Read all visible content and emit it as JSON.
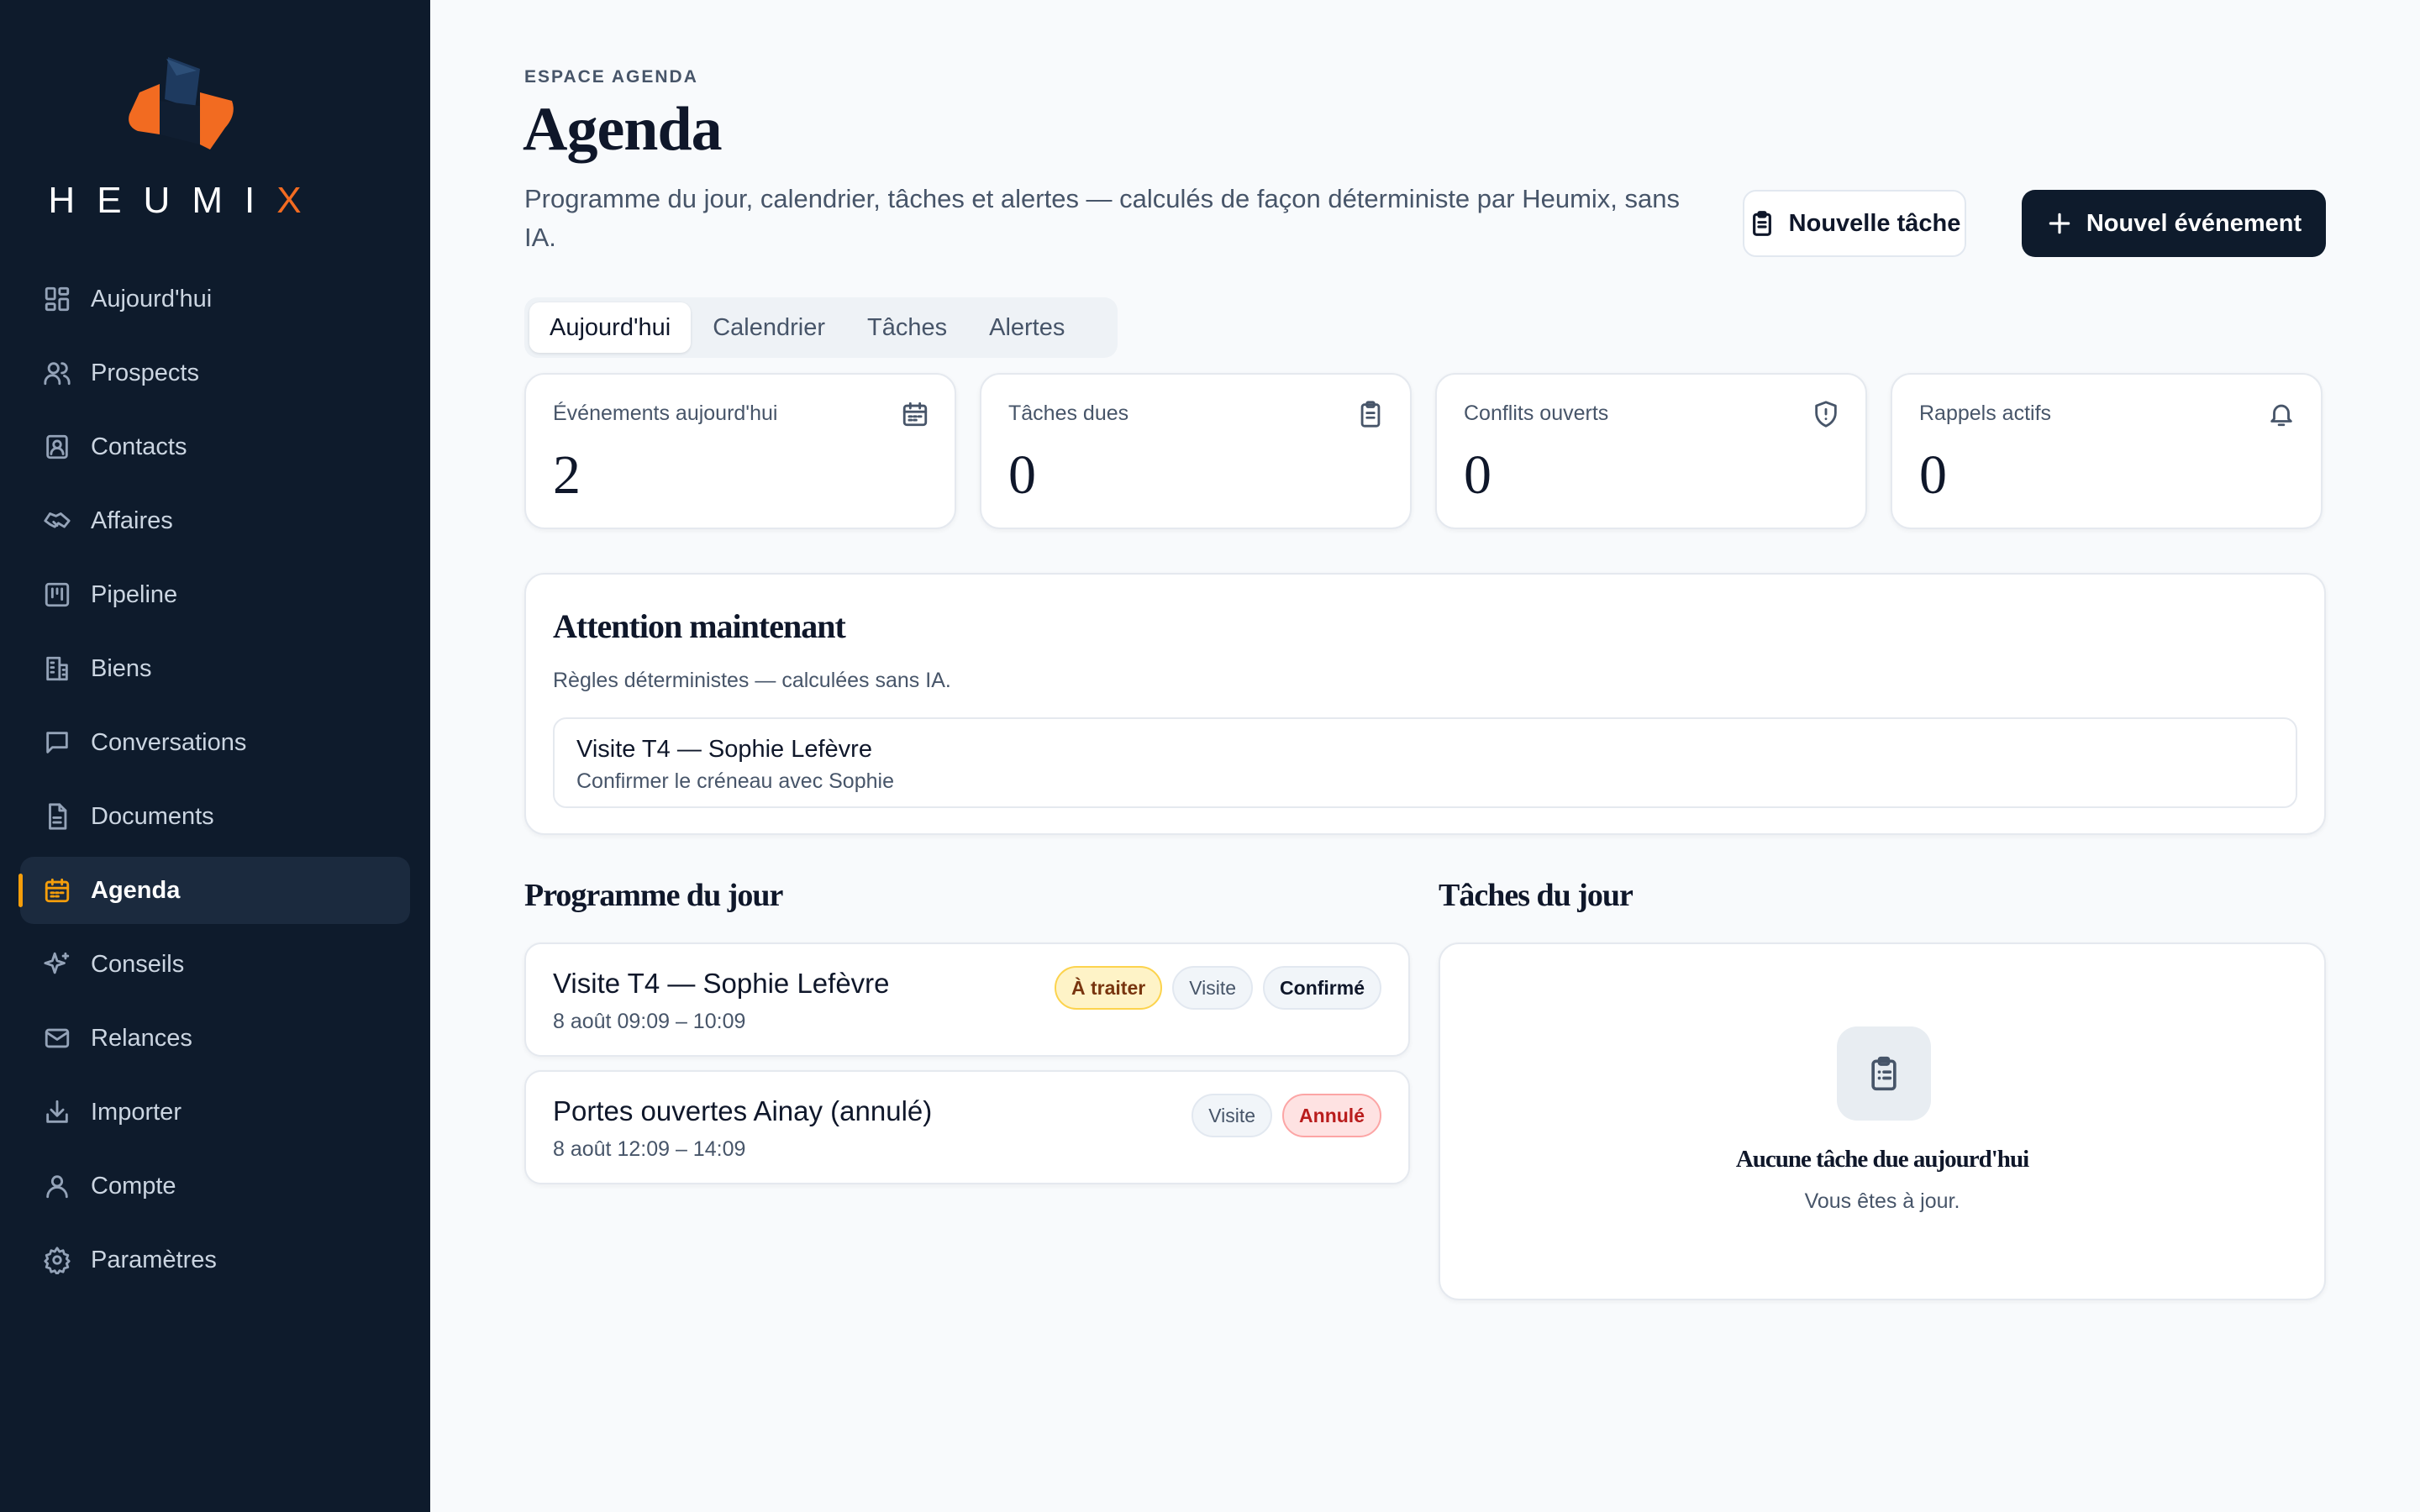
{
  "brand": {
    "name_main": "HEUMI",
    "name_accent": "X",
    "accent_color": "#f26b21",
    "dark_color": "#0e1b2c"
  },
  "sidebar": {
    "items": [
      {
        "label": "Aujourd'hui",
        "icon": "dashboard-icon"
      },
      {
        "label": "Prospects",
        "icon": "users-icon"
      },
      {
        "label": "Contacts",
        "icon": "contact-card-icon"
      },
      {
        "label": "Affaires",
        "icon": "handshake-icon"
      },
      {
        "label": "Pipeline",
        "icon": "kanban-icon"
      },
      {
        "label": "Biens",
        "icon": "building-icon"
      },
      {
        "label": "Conversations",
        "icon": "chat-icon"
      },
      {
        "label": "Documents",
        "icon": "file-text-icon"
      },
      {
        "label": "Agenda",
        "icon": "calendar-icon",
        "active": true
      },
      {
        "label": "Conseils",
        "icon": "sparkles-icon"
      },
      {
        "label": "Relances",
        "icon": "mail-icon"
      },
      {
        "label": "Importer",
        "icon": "import-icon"
      },
      {
        "label": "Compte",
        "icon": "user-icon"
      },
      {
        "label": "Paramètres",
        "icon": "gear-icon"
      }
    ]
  },
  "header": {
    "eyebrow": "ESPACE AGENDA",
    "title": "Agenda",
    "subtitle": "Programme du jour, calendrier, tâches et alertes — calculés de façon déterministe par Heumix, sans IA.",
    "new_task_label": "Nouvelle tâche",
    "new_event_label": "Nouvel événement"
  },
  "tabs": [
    {
      "label": "Aujourd'hui",
      "active": true
    },
    {
      "label": "Calendrier"
    },
    {
      "label": "Tâches"
    },
    {
      "label": "Alertes"
    }
  ],
  "stats": [
    {
      "label": "Événements aujourd'hui",
      "value": "2",
      "icon": "calendar-icon"
    },
    {
      "label": "Tâches dues",
      "value": "0",
      "icon": "clipboard-icon"
    },
    {
      "label": "Conflits ouverts",
      "value": "0",
      "icon": "shield-alert-icon"
    },
    {
      "label": "Rappels actifs",
      "value": "0",
      "icon": "bell-icon"
    }
  ],
  "attention": {
    "title": "Attention maintenant",
    "subtitle": "Règles déterministes — calculées sans IA.",
    "items": [
      {
        "title": "Visite T4 — Sophie Lefèvre",
        "subtitle": "Confirmer le créneau avec Sophie"
      }
    ]
  },
  "programme": {
    "title": "Programme du jour",
    "events": [
      {
        "title": "Visite T4 — Sophie Lefèvre",
        "time": "8 août 09:09 – 10:09",
        "badges": [
          "À traiter",
          "Visite",
          "Confirmé"
        ]
      },
      {
        "title": "Portes ouvertes Ainay (annulé)",
        "time": "8 août 12:09 – 14:09",
        "badges": [
          "Visite",
          "Annulé"
        ]
      }
    ]
  },
  "tasks": {
    "title": "Tâches du jour",
    "empty_title": "Aucune tâche due aujourd'hui",
    "empty_subtitle": "Vous êtes à jour."
  }
}
